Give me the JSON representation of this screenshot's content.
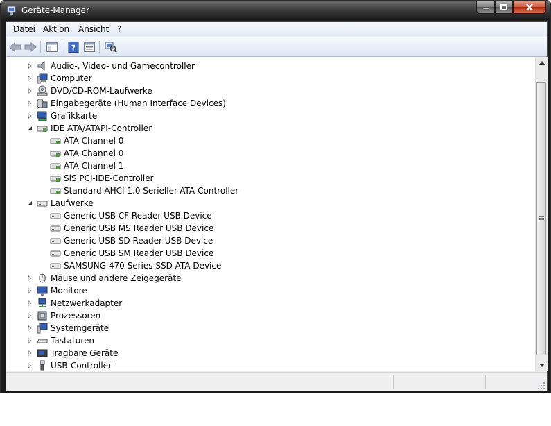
{
  "window": {
    "title": "Geräte-Manager"
  },
  "menu": {
    "items": [
      "Datei",
      "Aktion",
      "Ansicht",
      "?"
    ]
  },
  "toolbar": {
    "buttons": [
      "back-arrow-icon",
      "forward-arrow-icon",
      "show-hide-console-tree-icon",
      "help-icon",
      "properties-icon",
      "scan-hardware-changes-icon"
    ]
  },
  "tree": {
    "top": [
      {
        "label": "Audio-, Video- und Gamecontroller",
        "icon": "speaker-icon",
        "expanded": false
      },
      {
        "label": "Computer",
        "icon": "computer-icon",
        "expanded": false
      },
      {
        "label": "DVD/CD-ROM-Laufwerke",
        "icon": "dvd-drive-icon",
        "expanded": false
      },
      {
        "label": "Eingabegeräte (Human Interface Devices)",
        "icon": "hid-icon",
        "expanded": false
      },
      {
        "label": "Grafikkarte",
        "icon": "display-adapter-icon",
        "expanded": false
      },
      {
        "label": "IDE ATA/ATAPI-Controller",
        "icon": "ide-controller-icon",
        "expanded": true
      }
    ],
    "ide_children": [
      "ATA Channel 0",
      "ATA Channel 0",
      "ATA Channel 1",
      "SiS PCI-IDE-Controller",
      "Standard AHCI 1.0 Serieller-ATA-Controller"
    ],
    "drives_label": "Laufwerke",
    "drives_children": [
      "Generic USB CF Reader USB Device",
      "Generic USB MS Reader USB Device",
      "Generic USB SD Reader USB Device",
      "Generic USB SM Reader USB Device",
      "SAMSUNG 470 Series SSD ATA Device"
    ],
    "bottom": [
      {
        "label": "Mäuse und andere Zeigegeräte",
        "icon": "mouse-icon"
      },
      {
        "label": "Monitore",
        "icon": "monitor-icon"
      },
      {
        "label": "Netzwerkadapter",
        "icon": "network-adapter-icon"
      },
      {
        "label": "Prozessoren",
        "icon": "processor-icon"
      },
      {
        "label": "Systemgeräte",
        "icon": "system-devices-icon"
      },
      {
        "label": "Tastaturen",
        "icon": "keyboard-icon"
      },
      {
        "label": "Tragbare Geräte",
        "icon": "portable-devices-icon"
      },
      {
        "label": "USB-Controller",
        "icon": "usb-icon"
      }
    ]
  },
  "statusbar": {
    "text": ""
  }
}
